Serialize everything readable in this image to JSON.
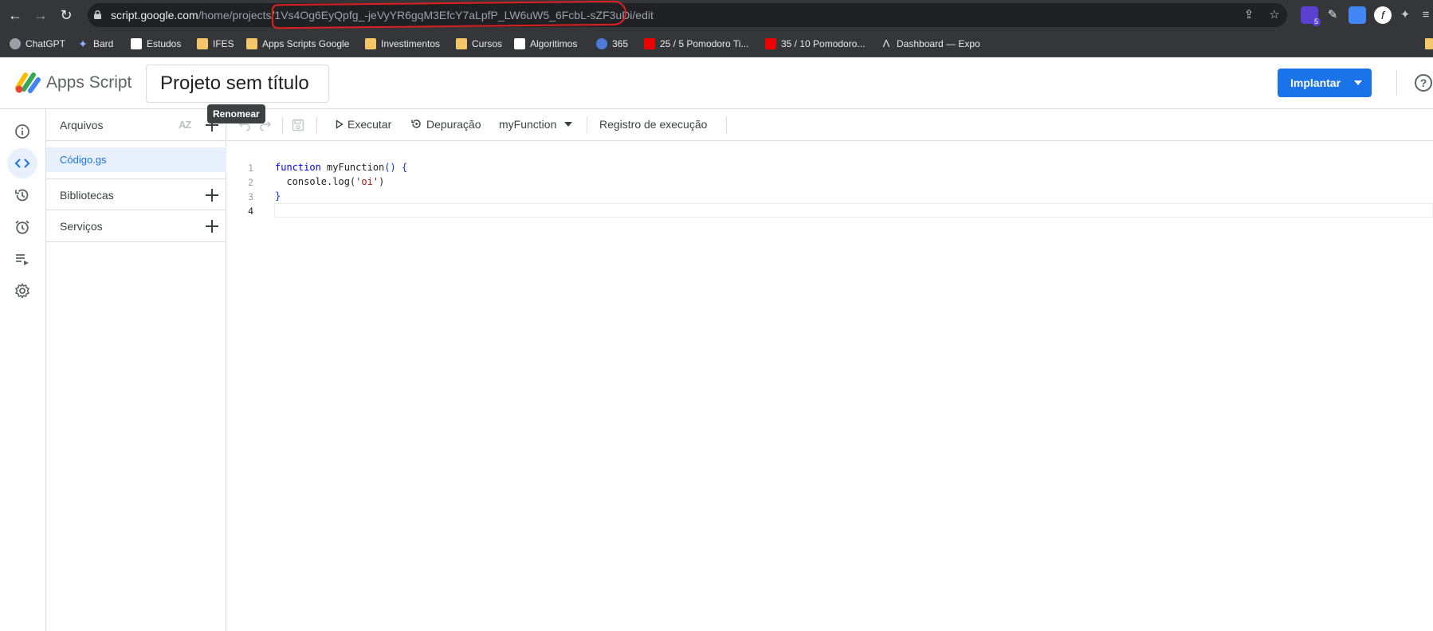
{
  "browser": {
    "url_host": "script.google.com",
    "url_path": "/home/projects/1Vs4Og6EyQpfg_-jeVyYR6gqM3EfcY7aLpfP_LW6uW5_6FcbL-sZF3uDi/edit",
    "extension_badge": "5",
    "bookmarks": [
      {
        "label": "ChatGPT",
        "icon": "chatgpt-icon"
      },
      {
        "label": "Bard",
        "icon": "bard-icon"
      },
      {
        "label": "Estudos",
        "icon": "trello-icon"
      },
      {
        "label": "IFES",
        "icon": "folder-icon"
      },
      {
        "label": "Apps Scripts Google",
        "icon": "folder-icon"
      },
      {
        "label": "Investimentos",
        "icon": "folder-icon"
      },
      {
        "label": "Cursos",
        "icon": "folder-icon"
      },
      {
        "label": "Algoritimos",
        "icon": "va-icon"
      },
      {
        "label": "365",
        "icon": "365-icon"
      },
      {
        "label": "25 / 5 Pomodoro Ti...",
        "icon": "youtube-icon"
      },
      {
        "label": "35 / 10 Pomodoro...",
        "icon": "youtube-icon"
      },
      {
        "label": "Dashboard — Expo",
        "icon": "expo-icon"
      }
    ]
  },
  "app": {
    "brand": "Apps Script",
    "project_title": "Projeto sem título",
    "deploy_label": "Implantar",
    "tooltip": "Renomear"
  },
  "files_panel": {
    "files_title": "Arquivos",
    "sort_label": "AZ",
    "files": [
      "Código.gs"
    ],
    "libraries_title": "Bibliotecas",
    "services_title": "Serviços"
  },
  "toolbar": {
    "run_label": "Executar",
    "debug_label": "Depuração",
    "function_selected": "myFunction",
    "exec_log_label": "Registro de execução"
  },
  "editor": {
    "line_numbers": [
      "1",
      "2",
      "3",
      "4"
    ],
    "line1_kw": "function",
    "line1_name": " myFunction",
    "line1_parens": "()",
    "line1_brace": " {",
    "line2_indent": "  console.log(",
    "line2_string": "'oi'",
    "line2_close": ")",
    "line3_brace": "}"
  },
  "colors": {
    "accent": "#1a73e8",
    "chrome_bar": "#35363a",
    "url_highlight": "#e02020"
  }
}
